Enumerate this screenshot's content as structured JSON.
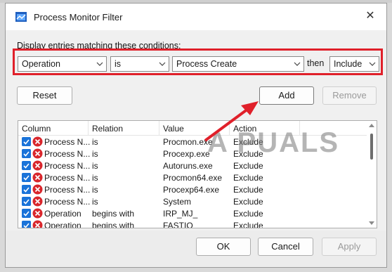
{
  "window": {
    "title": "Process Monitor Filter",
    "close_glyph": "✕"
  },
  "conditions": {
    "label": "Display entries matching these conditions:",
    "column": "Operation",
    "relation": "is",
    "value": "Process Create",
    "then_label": "then",
    "action": "Include"
  },
  "buttons": {
    "reset": "Reset",
    "add": "Add",
    "remove": "Remove",
    "ok": "OK",
    "cancel": "Cancel",
    "apply": "Apply"
  },
  "list": {
    "columns": [
      "Column",
      "Relation",
      "Value",
      "Action"
    ],
    "rows": [
      {
        "column": "Process N...",
        "relation": "is",
        "value": "Procmon.exe",
        "action": "Exclude"
      },
      {
        "column": "Process N...",
        "relation": "is",
        "value": "Procexp.exe",
        "action": "Exclude"
      },
      {
        "column": "Process N...",
        "relation": "is",
        "value": "Autoruns.exe",
        "action": "Exclude"
      },
      {
        "column": "Process N...",
        "relation": "is",
        "value": "Procmon64.exe",
        "action": "Exclude"
      },
      {
        "column": "Process N...",
        "relation": "is",
        "value": "Procexp64.exe",
        "action": "Exclude"
      },
      {
        "column": "Process N...",
        "relation": "is",
        "value": "System",
        "action": "Exclude"
      },
      {
        "column": "Operation",
        "relation": "begins with",
        "value": "IRP_MJ_",
        "action": "Exclude"
      },
      {
        "column": "Operation",
        "relation": "begins with",
        "value": "FASTIO_",
        "action": "Exclude"
      }
    ]
  },
  "watermark": "A PUALS",
  "colors": {
    "highlight": "#e0202a",
    "checkbox": "#1a73d9",
    "exclude_icon": "#d9262c"
  }
}
